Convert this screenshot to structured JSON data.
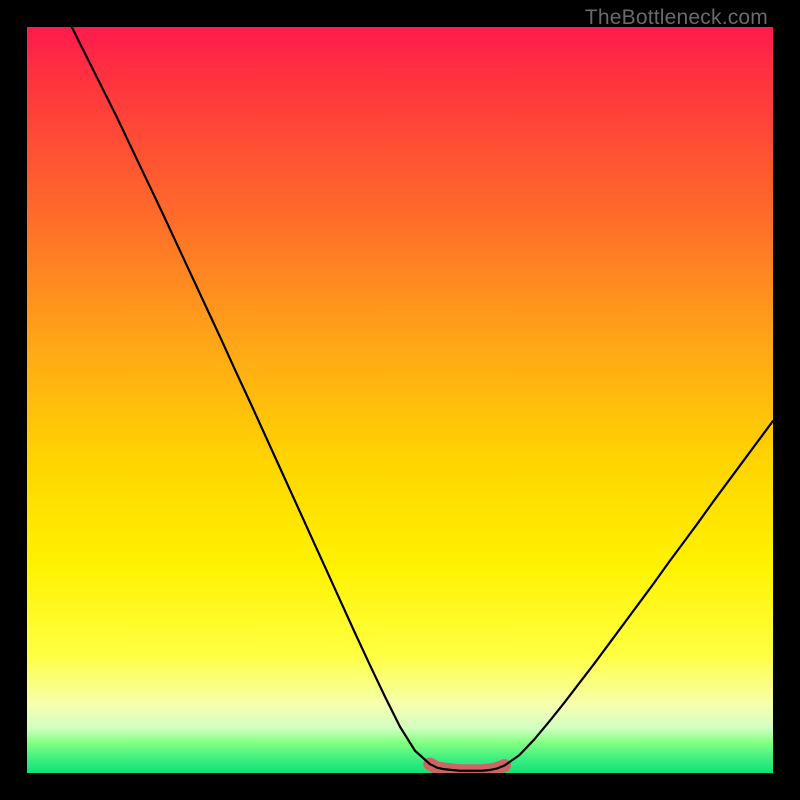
{
  "watermark": "TheBottleneck.com",
  "colors": {
    "curve": "#000000",
    "highlight": "#d06464",
    "top_gradient": "#ff1a4d",
    "bottom_gradient": "#10e078"
  },
  "chart_data": {
    "type": "line",
    "title": "",
    "xlabel": "",
    "ylabel": "",
    "xlim": [
      0,
      100
    ],
    "ylim": [
      0,
      100
    ],
    "x": [
      6,
      8,
      10,
      12,
      14,
      16,
      18,
      20,
      22,
      24,
      26,
      28,
      30,
      32,
      34,
      36,
      38,
      40,
      42,
      44,
      46,
      48,
      50,
      52,
      54,
      55,
      56,
      57,
      58,
      59,
      60,
      61,
      62,
      63,
      64,
      66,
      68,
      70,
      72,
      74,
      76,
      78,
      80,
      82,
      84,
      86,
      88,
      90,
      92,
      94,
      96,
      98,
      100
    ],
    "y": [
      100,
      96.0,
      92.0,
      88.0,
      83.8,
      79.6,
      75.4,
      71.1,
      66.8,
      62.5,
      58.2,
      53.8,
      49.5,
      45.1,
      40.7,
      36.3,
      31.9,
      27.5,
      23.1,
      18.7,
      14.4,
      10.2,
      6.2,
      3.0,
      1.2,
      0.7,
      0.5,
      0.4,
      0.3,
      0.3,
      0.3,
      0.3,
      0.4,
      0.6,
      1.0,
      2.4,
      4.5,
      6.9,
      9.4,
      12.0,
      14.6,
      17.3,
      20.0,
      22.7,
      25.4,
      28.2,
      30.9,
      33.6,
      36.4,
      39.1,
      41.8,
      44.5,
      47.2
    ],
    "highlight_range_x": [
      54,
      64
    ],
    "annotations": []
  }
}
